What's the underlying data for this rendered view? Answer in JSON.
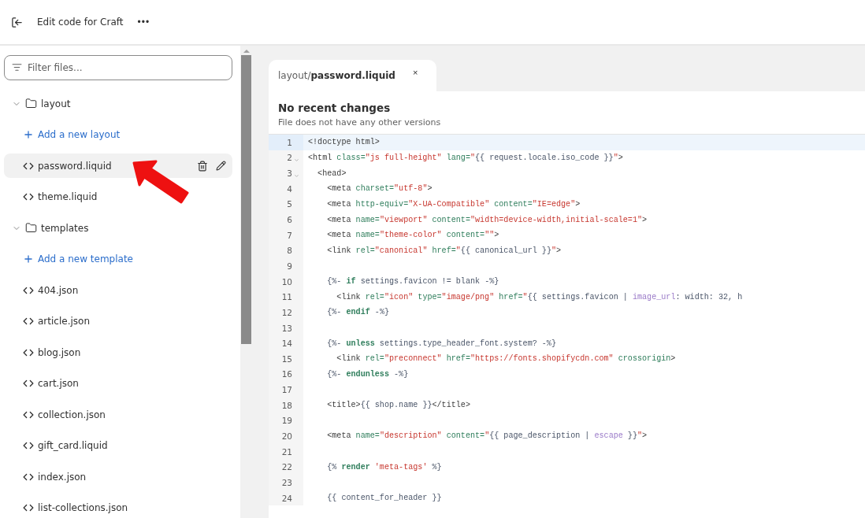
{
  "header": {
    "title": "Edit code for Craft",
    "more": "•••"
  },
  "filter": {
    "placeholder": "Filter files..."
  },
  "tree": [
    {
      "kind": "folder",
      "label": "layout",
      "expanded": true,
      "children": [
        {
          "kind": "add",
          "label": "Add a new layout"
        },
        {
          "kind": "file",
          "label": "password.liquid",
          "selected": true
        },
        {
          "kind": "file",
          "label": "theme.liquid",
          "selected": false
        }
      ]
    },
    {
      "kind": "folder",
      "label": "templates",
      "expanded": true,
      "children": [
        {
          "kind": "add",
          "label": "Add a new template"
        },
        {
          "kind": "file",
          "label": "404.json",
          "selected": false
        },
        {
          "kind": "file",
          "label": "article.json",
          "selected": false
        },
        {
          "kind": "file",
          "label": "blog.json",
          "selected": false
        },
        {
          "kind": "file",
          "label": "cart.json",
          "selected": false
        },
        {
          "kind": "file",
          "label": "collection.json",
          "selected": false
        },
        {
          "kind": "file",
          "label": "gift_card.liquid",
          "selected": false
        },
        {
          "kind": "file",
          "label": "index.json",
          "selected": false
        },
        {
          "kind": "file",
          "label": "list-collections.json",
          "selected": false
        }
      ]
    }
  ],
  "tabs": [
    {
      "folder": "layout/",
      "file": "password.liquid",
      "close": "×",
      "selected": true
    }
  ],
  "history": {
    "title": "No recent changes",
    "subtitle": "File does not have any other versions"
  },
  "code": [
    {
      "number": "1",
      "fold": false,
      "current": true,
      "tokens": [
        {
          "kind": "tag",
          "text": "<!doctype html>"
        }
      ]
    },
    {
      "number": "2",
      "fold": true,
      "current": false,
      "tokens": [
        {
          "kind": "tag",
          "text": "<html "
        },
        {
          "kind": "attr",
          "text": "class="
        },
        {
          "kind": "str",
          "text": "\"js full-height\""
        },
        {
          "kind": "attr",
          "text": " lang="
        },
        {
          "kind": "str",
          "text": "\""
        },
        {
          "kind": "var",
          "text": "{{ request.locale.iso_code }}"
        },
        {
          "kind": "str",
          "text": "\""
        },
        {
          "kind": "tag",
          "text": ">"
        }
      ]
    },
    {
      "number": "3",
      "fold": true,
      "current": false,
      "tokens": [
        {
          "kind": "tag",
          "text": "  <head>"
        }
      ]
    },
    {
      "number": "4",
      "fold": false,
      "current": false,
      "tokens": [
        {
          "kind": "tag",
          "text": "    <meta "
        },
        {
          "kind": "attr",
          "text": "charset="
        },
        {
          "kind": "str",
          "text": "\"utf-8\""
        },
        {
          "kind": "tag",
          "text": ">"
        }
      ]
    },
    {
      "number": "5",
      "fold": false,
      "current": false,
      "tokens": [
        {
          "kind": "tag",
          "text": "    <meta "
        },
        {
          "kind": "attr",
          "text": "http-equiv="
        },
        {
          "kind": "str",
          "text": "\"X-UA-Compatible\""
        },
        {
          "kind": "attr",
          "text": " content="
        },
        {
          "kind": "str",
          "text": "\"IE=edge\""
        },
        {
          "kind": "tag",
          "text": ">"
        }
      ]
    },
    {
      "number": "6",
      "fold": false,
      "current": false,
      "tokens": [
        {
          "kind": "tag",
          "text": "    <meta "
        },
        {
          "kind": "attr",
          "text": "name="
        },
        {
          "kind": "str",
          "text": "\"viewport\""
        },
        {
          "kind": "attr",
          "text": " content="
        },
        {
          "kind": "str",
          "text": "\"width=device-width,initial-scale=1\""
        },
        {
          "kind": "tag",
          "text": ">"
        }
      ]
    },
    {
      "number": "7",
      "fold": false,
      "current": false,
      "tokens": [
        {
          "kind": "tag",
          "text": "    <meta "
        },
        {
          "kind": "attr",
          "text": "name="
        },
        {
          "kind": "str",
          "text": "\"theme-color\""
        },
        {
          "kind": "attr",
          "text": " content="
        },
        {
          "kind": "str",
          "text": "\"\""
        },
        {
          "kind": "tag",
          "text": ">"
        }
      ]
    },
    {
      "number": "8",
      "fold": false,
      "current": false,
      "tokens": [
        {
          "kind": "tag",
          "text": "    <link "
        },
        {
          "kind": "attr",
          "text": "rel="
        },
        {
          "kind": "str",
          "text": "\"canonical\""
        },
        {
          "kind": "attr",
          "text": " href="
        },
        {
          "kind": "str",
          "text": "\""
        },
        {
          "kind": "var",
          "text": "{{ canonical_url }}"
        },
        {
          "kind": "str",
          "text": "\""
        },
        {
          "kind": "tag",
          "text": ">"
        }
      ]
    },
    {
      "number": "9",
      "fold": false,
      "current": false
    },
    {
      "number": "10",
      "fold": false,
      "current": false,
      "tokens": [
        {
          "kind": "var",
          "text": "    {%- "
        },
        {
          "kind": "kw",
          "text": "if"
        },
        {
          "kind": "var",
          "text": " settings.favicon != blank -%}"
        }
      ]
    },
    {
      "number": "11",
      "fold": false,
      "current": false,
      "tokens": [
        {
          "kind": "tag",
          "text": "      <link "
        },
        {
          "kind": "attr",
          "text": "rel="
        },
        {
          "kind": "str",
          "text": "\"icon\""
        },
        {
          "kind": "attr",
          "text": " type="
        },
        {
          "kind": "str",
          "text": "\"image/png\""
        },
        {
          "kind": "attr",
          "text": " href="
        },
        {
          "kind": "str",
          "text": "\""
        },
        {
          "kind": "var",
          "text": "{{ settings.favicon | "
        },
        {
          "kind": "filter",
          "text": "image_url"
        },
        {
          "kind": "var",
          "text": ": width: 32, h"
        }
      ]
    },
    {
      "number": "12",
      "fold": false,
      "current": false,
      "tokens": [
        {
          "kind": "var",
          "text": "    {%- "
        },
        {
          "kind": "kw",
          "text": "endif"
        },
        {
          "kind": "var",
          "text": " -%}"
        }
      ]
    },
    {
      "number": "13",
      "fold": false,
      "current": false
    },
    {
      "number": "14",
      "fold": false,
      "current": false,
      "tokens": [
        {
          "kind": "var",
          "text": "    {%- "
        },
        {
          "kind": "kw",
          "text": "unless"
        },
        {
          "kind": "var",
          "text": " settings.type_header_font.system? -%}"
        }
      ]
    },
    {
      "number": "15",
      "fold": false,
      "current": false,
      "tokens": [
        {
          "kind": "tag",
          "text": "      <link "
        },
        {
          "kind": "attr",
          "text": "rel="
        },
        {
          "kind": "str",
          "text": "\"preconnect\""
        },
        {
          "kind": "attr",
          "text": " href="
        },
        {
          "kind": "str",
          "text": "\"https://fonts.shopifycdn.com\""
        },
        {
          "kind": "attr",
          "text": " crossorigin"
        },
        {
          "kind": "tag",
          "text": ">"
        }
      ]
    },
    {
      "number": "16",
      "fold": false,
      "current": false,
      "tokens": [
        {
          "kind": "var",
          "text": "    {%- "
        },
        {
          "kind": "kw",
          "text": "endunless"
        },
        {
          "kind": "var",
          "text": " -%}"
        }
      ]
    },
    {
      "number": "17",
      "fold": false,
      "current": false
    },
    {
      "number": "18",
      "fold": false,
      "current": false,
      "tokens": [
        {
          "kind": "tag",
          "text": "    <title>"
        },
        {
          "kind": "var",
          "text": "{{ shop.name }}"
        },
        {
          "kind": "tag",
          "text": "</title>"
        }
      ]
    },
    {
      "number": "19",
      "fold": false,
      "current": false
    },
    {
      "number": "20",
      "fold": false,
      "current": false,
      "tokens": [
        {
          "kind": "tag",
          "text": "    <meta "
        },
        {
          "kind": "attr",
          "text": "name="
        },
        {
          "kind": "str",
          "text": "\"description\""
        },
        {
          "kind": "attr",
          "text": " content="
        },
        {
          "kind": "str",
          "text": "\""
        },
        {
          "kind": "var",
          "text": "{{ page_description | "
        },
        {
          "kind": "filter",
          "text": "escape"
        },
        {
          "kind": "var",
          "text": " }}"
        },
        {
          "kind": "str",
          "text": "\""
        },
        {
          "kind": "tag",
          "text": ">"
        }
      ]
    },
    {
      "number": "21",
      "fold": false,
      "current": false
    },
    {
      "number": "22",
      "fold": false,
      "current": false,
      "tokens": [
        {
          "kind": "var",
          "text": "    {% "
        },
        {
          "kind": "kw",
          "text": "render"
        },
        {
          "kind": "str",
          "text": " 'meta-tags'"
        },
        {
          "kind": "var",
          "text": " %}"
        }
      ]
    },
    {
      "number": "23",
      "fold": false,
      "current": false
    },
    {
      "number": "24",
      "fold": false,
      "current": false,
      "tokens": [
        {
          "kind": "var",
          "text": "    {{ content_for_header }}"
        }
      ]
    }
  ]
}
